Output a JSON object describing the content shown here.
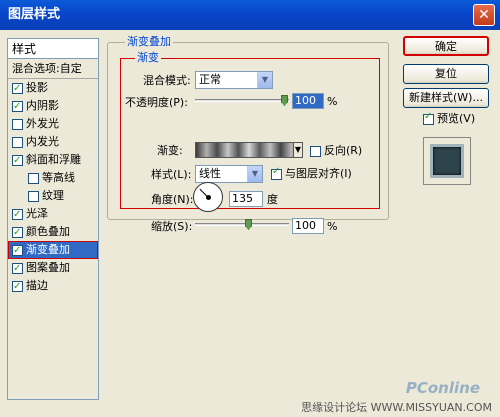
{
  "window": {
    "title": "图层样式"
  },
  "styles": {
    "header": "样式",
    "blend_options": "混合选项:自定",
    "items": [
      {
        "label": "投影",
        "checked": true
      },
      {
        "label": "内阴影",
        "checked": true
      },
      {
        "label": "外发光",
        "checked": false
      },
      {
        "label": "内发光",
        "checked": false
      },
      {
        "label": "斜面和浮雕",
        "checked": true
      },
      {
        "label": "等高线",
        "checked": false
      },
      {
        "label": "纹理",
        "checked": false
      },
      {
        "label": "光泽",
        "checked": true
      },
      {
        "label": "颜色叠加",
        "checked": true
      },
      {
        "label": "渐变叠加",
        "checked": true,
        "selected": true
      },
      {
        "label": "图案叠加",
        "checked": true
      },
      {
        "label": "描边",
        "checked": true
      }
    ]
  },
  "panel": {
    "group_title": "渐变叠加",
    "sub_title": "渐变",
    "blend_mode_label": "混合模式:",
    "blend_mode_value": "正常",
    "opacity_label": "不透明度(P):",
    "opacity_value": "100",
    "opacity_unit": "%",
    "gradient_label": "渐变:",
    "reverse_label": "反向(R)",
    "reverse_checked": false,
    "style_label": "样式(L):",
    "style_value": "线性",
    "align_label": "与图层对齐(I)",
    "align_checked": true,
    "angle_label": "角度(N):",
    "angle_value": "135",
    "angle_unit": "度",
    "scale_label": "缩放(S):",
    "scale_value": "100",
    "scale_unit": "%"
  },
  "buttons": {
    "ok": "确定",
    "reset": "复位",
    "new_style": "新建样式(W)...",
    "preview_label": "预览(V)",
    "preview_checked": true
  },
  "watermark": {
    "logo": "PConline",
    "text": "思缘设计论坛 WWW.MISSYUAN.COM"
  }
}
